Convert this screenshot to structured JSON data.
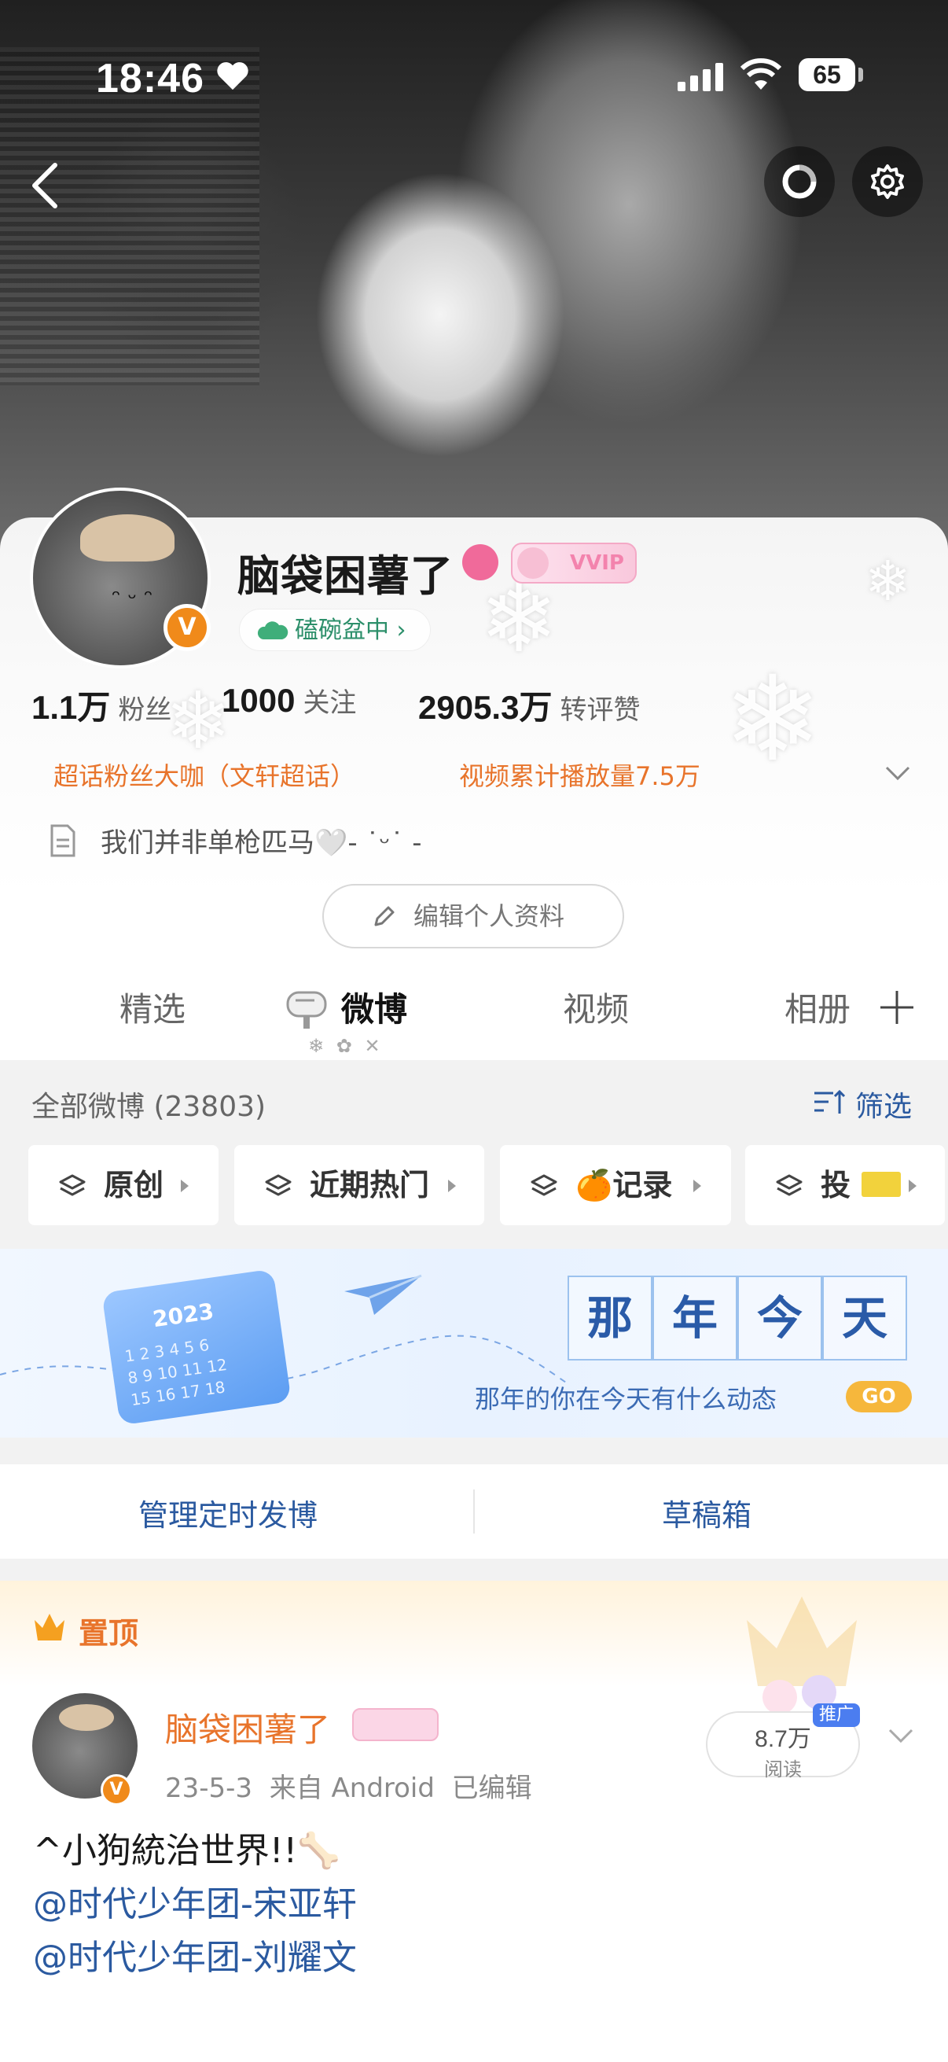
{
  "status_bar": {
    "time": "18:46",
    "battery": "65"
  },
  "profile": {
    "name": "脑袋困薯了",
    "vip_label": "VVIP",
    "status_chip": "磕碗盆中",
    "stats": [
      {
        "value": "1.1万",
        "label": "粉丝"
      },
      {
        "value": "1000",
        "label": "关注"
      },
      {
        "value": "2905.3万",
        "label": "转评赞"
      }
    ],
    "tag_links": [
      "超话粉丝大咖（文轩超话）",
      "视频累计播放量7.5万"
    ],
    "bio": "我们并非单枪匹马🤍- ˙ᵕ˙ -",
    "edit_button": "编辑个人资料"
  },
  "tabs": [
    "精选",
    "微博",
    "视频",
    "相册"
  ],
  "active_tab": "微博",
  "feed": {
    "header": "全部微博 (23803)",
    "filter_label": "筛选",
    "chips": [
      "原创",
      "近期热门",
      "🍊记录",
      "投"
    ],
    "banner": {
      "title_chars": [
        "那",
        "年",
        "今",
        "天"
      ],
      "subtitle": "那年的你在今天有什么动态",
      "go_label": "GO",
      "calendar_year": "2023"
    },
    "actions": [
      "管理定时发博",
      "草稿箱"
    ]
  },
  "pinned_post": {
    "pin_label": "置顶",
    "author": "脑袋困薯了",
    "date": "23-5-3",
    "source": "来自 Android",
    "edited": "已编辑",
    "read_count": "8.7万",
    "read_label": "阅读",
    "promo_label": "推广",
    "text_line1": "^小狗統治世界!!🦴",
    "mention1": "@时代少年团-宋亚轩",
    "mention2": "@时代少年团-刘耀文"
  },
  "colors": {
    "accent_orange": "#e8742b",
    "link_blue": "#2b5aa0",
    "verified": "#f08a1a"
  }
}
